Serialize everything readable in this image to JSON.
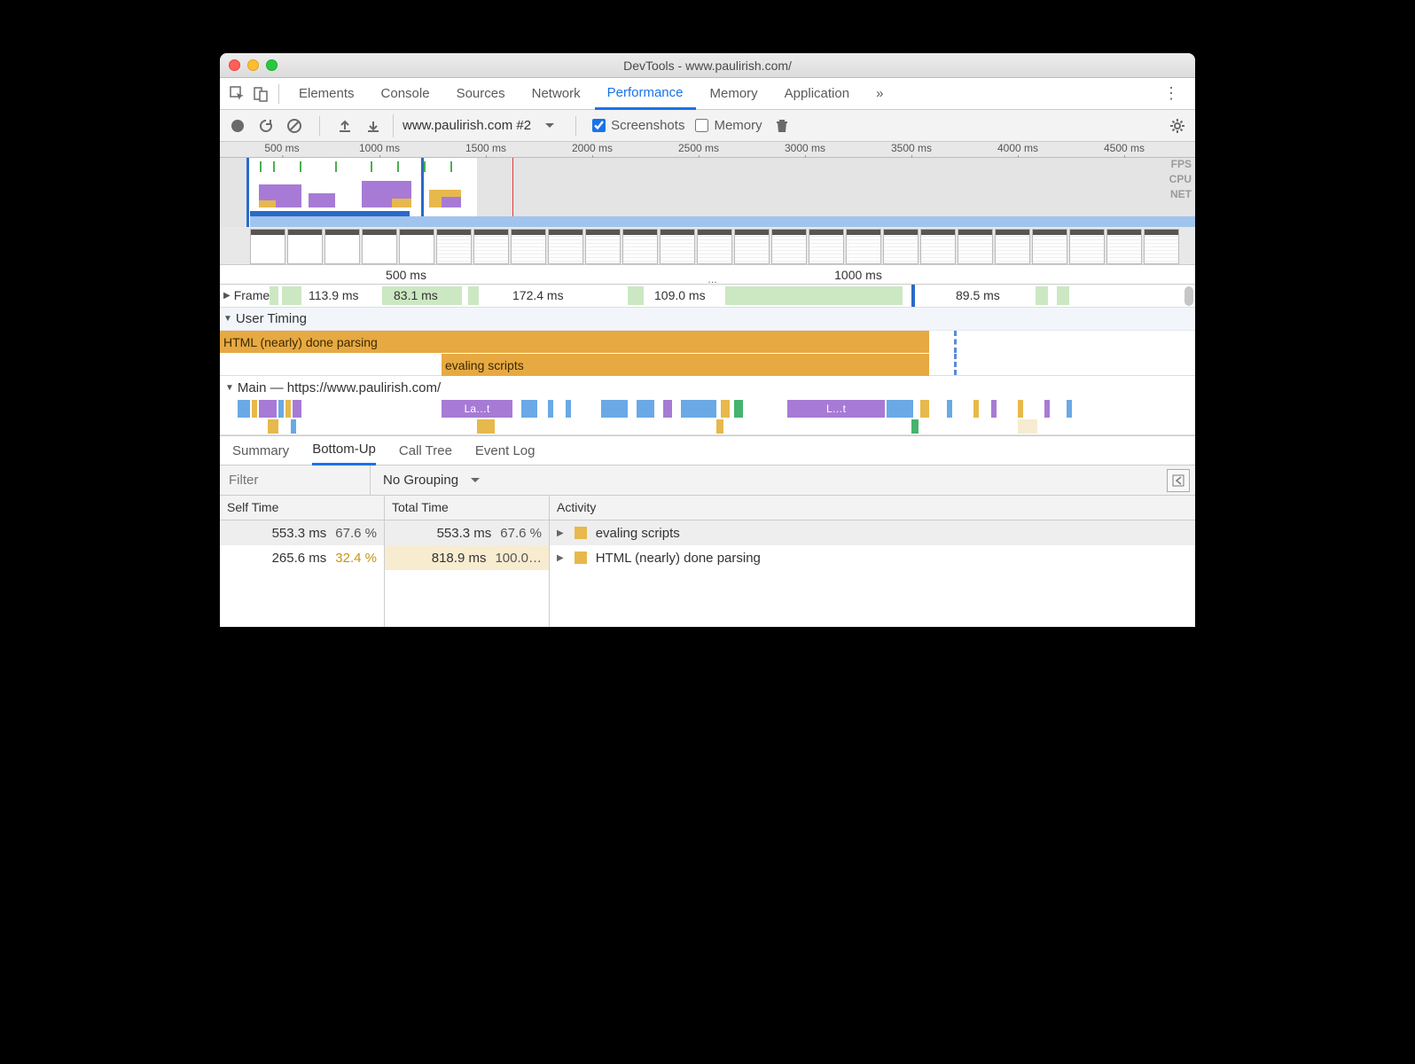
{
  "window_title": "DevTools - www.paulirish.com/",
  "tabs": [
    "Elements",
    "Console",
    "Sources",
    "Network",
    "Performance",
    "Memory",
    "Application"
  ],
  "active_tab": "Performance",
  "toolbar": {
    "profile_name": "www.paulirish.com #2",
    "screenshots_label": "Screenshots",
    "screenshots_checked": true,
    "memory_label": "Memory",
    "memory_checked": false
  },
  "overview": {
    "ticks": [
      "500 ms",
      "1000 ms",
      "1500 ms",
      "2000 ms",
      "2500 ms",
      "3000 ms",
      "3500 ms",
      "4000 ms",
      "4500 ms"
    ],
    "lane_labels": [
      "FPS",
      "CPU",
      "NET"
    ]
  },
  "main_ruler": {
    "ticks": [
      "500 ms",
      "1000 ms"
    ]
  },
  "frames": {
    "label": "Frames",
    "values": [
      "113.9 ms",
      "83.1 ms",
      "172.4 ms",
      "109.0 ms",
      "89.5 ms"
    ]
  },
  "user_timing": {
    "label": "User Timing",
    "bars": [
      "HTML (nearly) done parsing",
      "evaling scripts"
    ]
  },
  "main_thread": {
    "label": "Main — https://www.paulirish.com/",
    "snips": [
      "La…t",
      "L…t"
    ]
  },
  "bottom_tabs": [
    "Summary",
    "Bottom-Up",
    "Call Tree",
    "Event Log"
  ],
  "active_bottom_tab": "Bottom-Up",
  "filter_placeholder": "Filter",
  "grouping": "No Grouping",
  "columns": {
    "self": "Self Time",
    "total": "Total Time",
    "activity": "Activity"
  },
  "rows": [
    {
      "self_ms": "553.3 ms",
      "self_pct": "67.6 %",
      "total_ms": "553.3 ms",
      "total_pct": "67.6 %",
      "activity": "evaling scripts"
    },
    {
      "self_ms": "265.6 ms",
      "self_pct": "32.4 %",
      "total_ms": "818.9 ms",
      "total_pct": "100.0…",
      "activity": "HTML (nearly) done parsing"
    }
  ]
}
